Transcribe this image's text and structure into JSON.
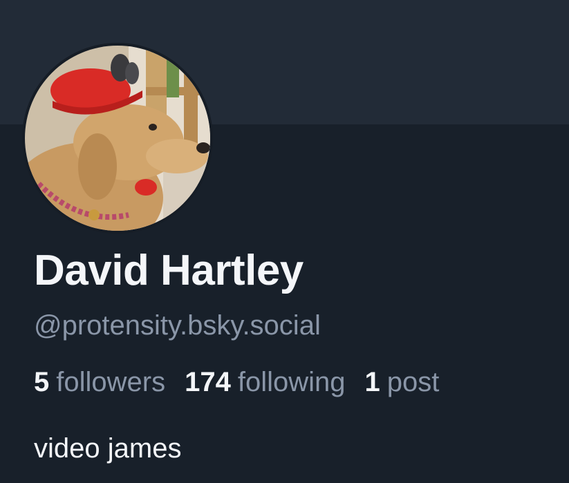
{
  "profile": {
    "display_name": "David Hartley",
    "handle": "@protensity.bsky.social",
    "bio": "video james"
  },
  "stats": {
    "followers": {
      "count": "5",
      "label": "followers"
    },
    "following": {
      "count": "174",
      "label": "following"
    },
    "posts": {
      "count": "1",
      "label": "post"
    }
  },
  "colors": {
    "banner": "#222b37",
    "background": "#18202a",
    "primary_text": "#f4f6f9",
    "secondary_text": "#8a96a8"
  },
  "icons": {
    "avatar": "dog-with-red-hat-photo"
  }
}
